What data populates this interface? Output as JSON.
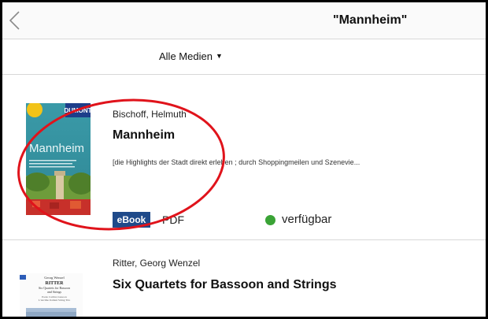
{
  "header": {
    "title": "\"Mannheim\"",
    "back_icon": "chevron-left-icon"
  },
  "filter": {
    "label": "Alle Medien",
    "caret": "▼"
  },
  "results": [
    {
      "author": "Bischoff, Helmuth",
      "title": "Mannheim",
      "description": "[die Highlights der Stadt direkt erleben ; durch Shoppingmeilen und Szenevie...",
      "cover": {
        "brand": "DUMONT",
        "sticker": "Mit Extra-Karte",
        "title": "Mannheim",
        "blurb": "Die Highlights der Stadt direkt erleben. Durch Shoppingmeilen und Szeneviertel bummeln. Die besten Adressen zum Ausgehen."
      },
      "media_badge": "eBook",
      "format": "PDF",
      "availability": "verfügbar",
      "availability_color": "#3aa336"
    },
    {
      "author": "Ritter, Georg Wenzel",
      "title": "Six Quartets for Bassoon and Strings",
      "cover": {
        "line1": "Georg Wenzel",
        "line2": "RITTER",
        "line3": "Six Quartets for Bassoon",
        "line4": "and Strings",
        "line5": "Paolo Carlini, bassoon",
        "line6": "L'Arcimo Italiani String Trio"
      }
    }
  ],
  "colors": {
    "accent": "#1f4a8a",
    "annotation": "#e0131b"
  }
}
